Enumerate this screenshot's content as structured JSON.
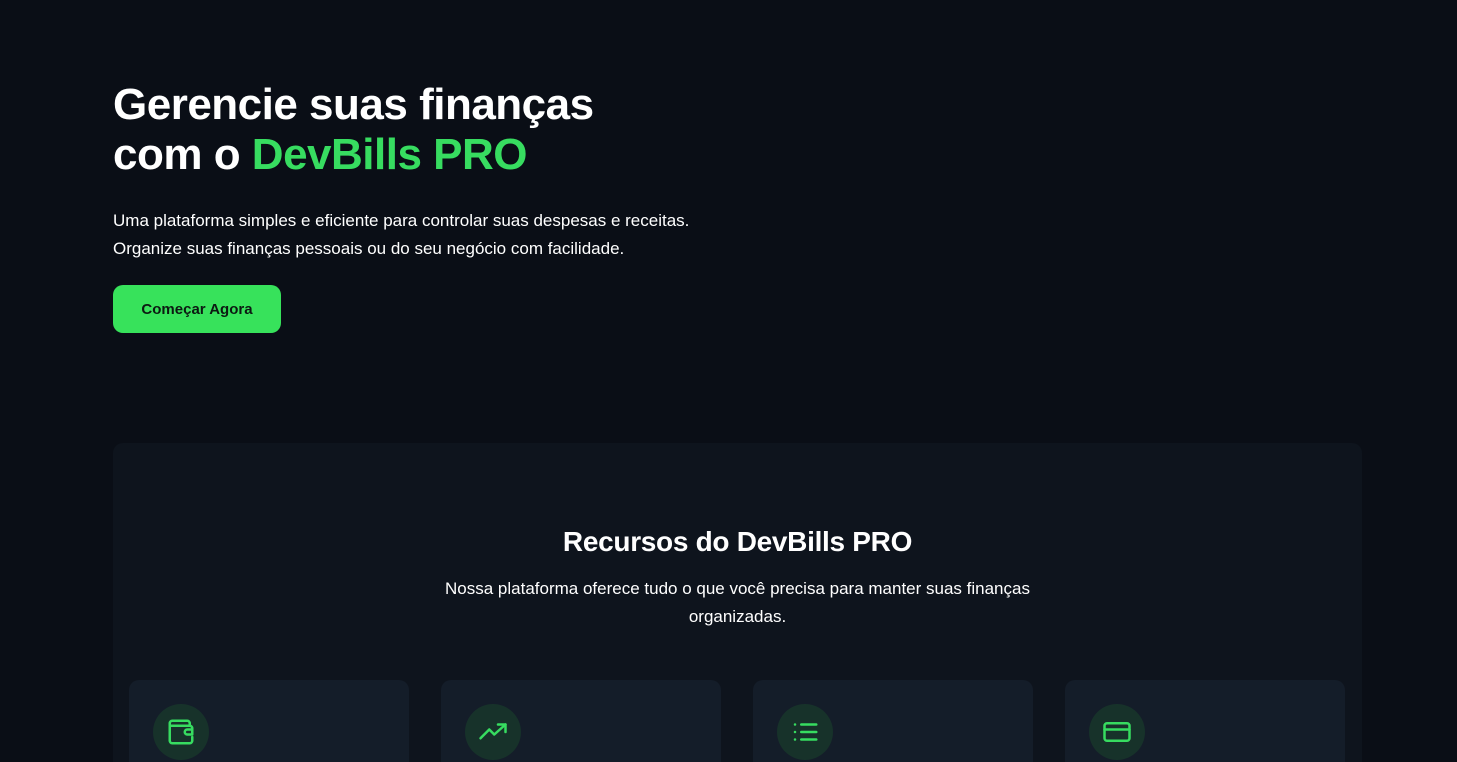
{
  "hero": {
    "title_line1": "Gerencie suas finanças",
    "title_line2_prefix": "com o ",
    "title_accent": "DevBills PRO",
    "description": "Uma plataforma simples e eficiente para controlar suas despesas e receitas. Organize suas finanças pessoais ou do seu negócio com facilidade.",
    "cta_label": "Começar Agora"
  },
  "features": {
    "title": "Recursos do DevBills PRO",
    "description": "Nossa plataforma oferece tudo o que você precisa para manter suas finanças organizadas.",
    "cards": [
      {
        "icon": "wallet-icon"
      },
      {
        "icon": "trending-up-icon"
      },
      {
        "icon": "list-icon"
      },
      {
        "icon": "credit-card-icon"
      }
    ]
  },
  "colors": {
    "background": "#0a0e16",
    "accent": "#37dc60",
    "button": "#37e25b",
    "section": "#0e141d",
    "card": "#141d29",
    "icon_circle": "#17322a"
  }
}
